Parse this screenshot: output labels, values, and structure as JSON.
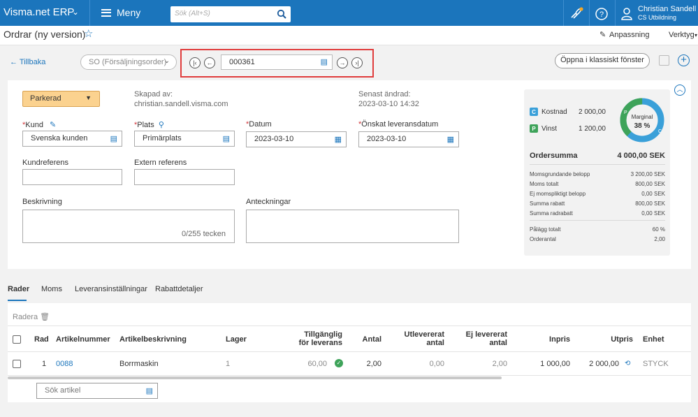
{
  "topbar": {
    "brand": "Visma.net ERP",
    "menu_label": "Meny",
    "search_placeholder": "Sök (Alt+S)",
    "user_name": "Christian Sandell",
    "user_company": "CS Utbildning"
  },
  "titlebar": {
    "page_title": "Ordrar (ny version)",
    "customize_label": "Anpassning",
    "tools_label": "Verktyg"
  },
  "toolbar": {
    "back_label": "Tillbaka",
    "order_type": "SO (Försäljningsorder)",
    "order_number": "000361",
    "open_classic_label": "Öppna i klassiskt fönster"
  },
  "form": {
    "status": "Parkerad",
    "created_by_label": "Skapad av:",
    "created_by_value": "christian.sandell.visma.com",
    "last_changed_label": "Senast ändrad:",
    "last_changed_value": "2023-03-10 14:32",
    "customer_label": "Kund",
    "customer_value": "Svenska kunden",
    "location_label": "Plats",
    "location_value": "Primärplats",
    "date_label": "Datum",
    "date_value": "2023-03-10",
    "requested_date_label": "Önskat leveransdatum",
    "requested_date_value": "2023-03-10",
    "customer_ref_label": "Kundreferens",
    "external_ref_label": "Extern referens",
    "description_label": "Beskrivning",
    "description_counter": "0/255 tecken",
    "notes_label": "Anteckningar",
    "required_marker": "*"
  },
  "summary": {
    "cost_badge": "C",
    "cost_label": "Kostnad",
    "cost_value": "2 000,00",
    "profit_badge": "P",
    "profit_label": "Vinst",
    "profit_value": "1 200,00",
    "margin_label": "Marginal",
    "margin_value": "38 %",
    "margin_fraction": 0.38,
    "order_total_label": "Ordersumma",
    "order_total_value": "4 000,00 SEK",
    "rows": [
      {
        "label": "Momsgrundande belopp",
        "value": "3 200,00 SEK"
      },
      {
        "label": "Moms totalt",
        "value": "800,00 SEK"
      },
      {
        "label": "Ej momspliktigt belopp",
        "value": "0,00 SEK"
      },
      {
        "label": "Summa rabatt",
        "value": "800,00 SEK"
      },
      {
        "label": "Summa radrabatt",
        "value": "0,00 SEK"
      },
      {
        "label": "Pålägg totalt",
        "value": "60 %"
      },
      {
        "label": "Orderantal",
        "value": "2,00"
      }
    ]
  },
  "tabs": [
    "Rader",
    "Moms",
    "Leveransinställningar",
    "Rabattdetaljer"
  ],
  "grid": {
    "delete_label": "Radera",
    "headers": [
      "Rad",
      "Artikelnummer",
      "Artikelbeskrivning",
      "Lager",
      "Tillgänglig för leverans",
      "Antal",
      "Utlevererat antal",
      "Ej levererat antal",
      "Inpris",
      "Utpris",
      "Enhet"
    ],
    "row": {
      "rad": "1",
      "artikelnummer": "0088",
      "beskrivning": "Borrmaskin",
      "lager": "1",
      "tillganglig": "60,00",
      "antal": "2,00",
      "utlevererat": "0,00",
      "ej_levererat": "2,00",
      "inpris": "1 000,00",
      "utpris": "2 000,00",
      "enhet": "STYCK"
    },
    "search_placeholder": "Sök artikel"
  },
  "colors": {
    "brand_blue": "#1b75bc",
    "status_orange": "#fbd28f",
    "profit_green": "#3ea35a",
    "cost_blue": "#3aa0d9",
    "highlight_red": "#e03c3c"
  }
}
